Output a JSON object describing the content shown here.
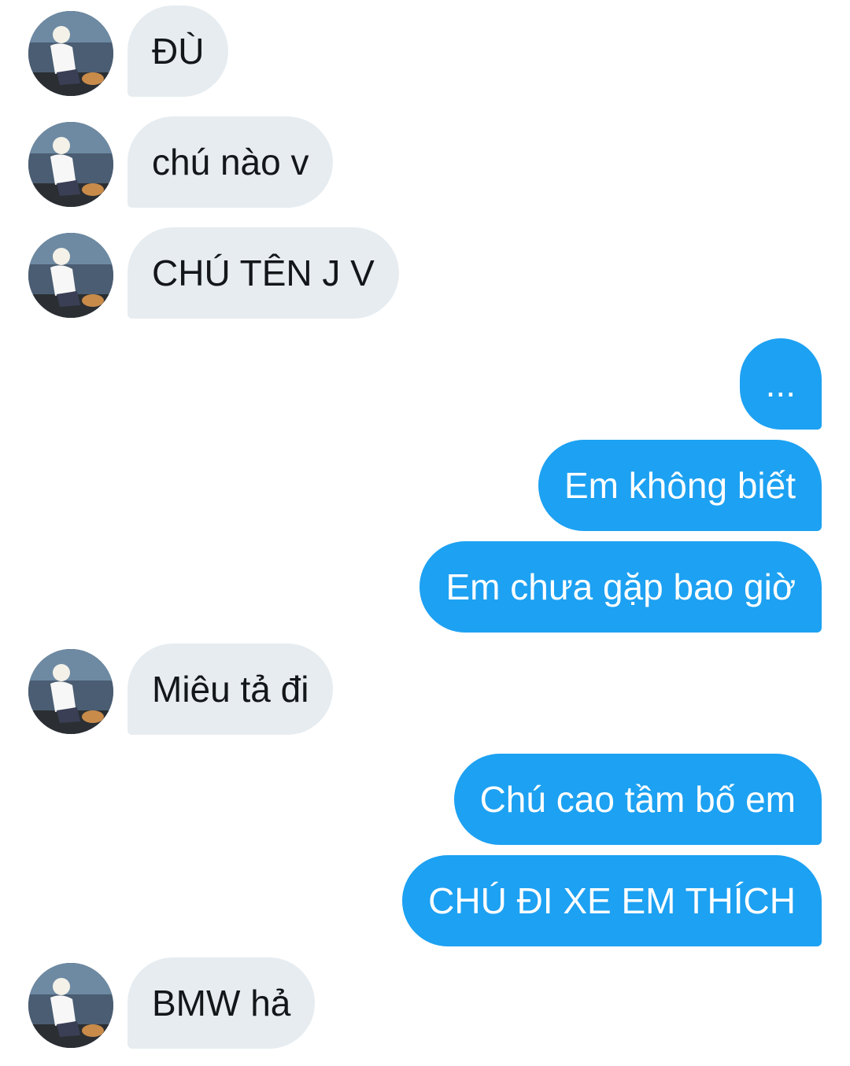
{
  "conversation": {
    "messages": [
      {
        "side": "in",
        "text": "ĐÙ"
      },
      {
        "side": "in",
        "text": "chú nào v"
      },
      {
        "side": "in",
        "text": "CHÚ TÊN J V"
      },
      {
        "side": "out",
        "text": "..."
      },
      {
        "side": "out",
        "text": "Em không biết"
      },
      {
        "side": "out",
        "text": "Em chưa gặp bao giờ"
      },
      {
        "side": "in",
        "text": "Miêu tả đi"
      },
      {
        "side": "out",
        "text": "Chú cao tầm bố em"
      },
      {
        "side": "out",
        "text": "CHÚ ĐI XE EM THÍCH"
      },
      {
        "side": "in",
        "text": "BMW hả"
      }
    ]
  },
  "colors": {
    "incoming_bubble": "#e6ecf0",
    "incoming_text": "#14171a",
    "outgoing_bubble": "#1da1f2",
    "outgoing_text": "#ffffff"
  },
  "icons": {
    "avatar": "contact-avatar-photo"
  }
}
